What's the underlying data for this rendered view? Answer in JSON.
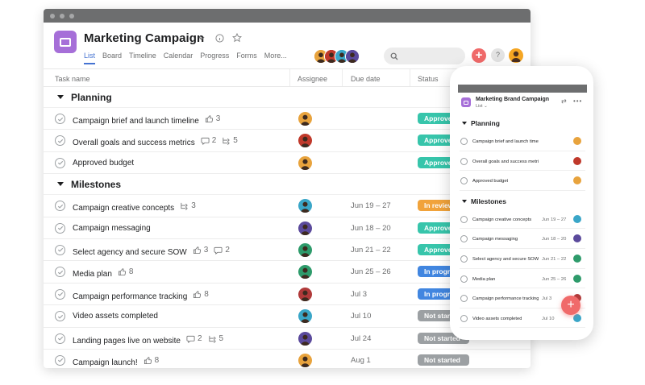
{
  "project": {
    "title": "Marketing Campaign",
    "tabs": [
      "List",
      "Board",
      "Timeline",
      "Calendar",
      "Progress",
      "Forms",
      "More..."
    ],
    "active_tab": "List",
    "icon": "project-list-icon",
    "accent": "#a66fd8"
  },
  "columns": {
    "task": "Task name",
    "assignee": "Assignee",
    "due": "Due date",
    "status": "Status"
  },
  "colors": {
    "approved": "#37c5ab",
    "in_review": "#f1a33b",
    "in_progress": "#4186e0",
    "not_started": "#9ca0a3",
    "add": "#f06a6a"
  },
  "sections": [
    {
      "title": "Planning",
      "tasks": [
        {
          "name": "Campaign brief and launch timeline",
          "likes": "3",
          "comments": "",
          "subtasks": "",
          "due": "",
          "status": "Approved",
          "status_key": "approved",
          "avatar": "#e8a33d"
        },
        {
          "name": "Overall goals and success metrics",
          "likes": "",
          "comments": "2",
          "subtasks": "5",
          "due": "",
          "status": "Approved",
          "status_key": "approved",
          "avatar": "#c0392b"
        },
        {
          "name": "Approved budget",
          "likes": "",
          "comments": "",
          "subtasks": "",
          "due": "",
          "status": "Approved",
          "status_key": "approved",
          "avatar": "#e8a33d"
        }
      ]
    },
    {
      "title": "Milestones",
      "tasks": [
        {
          "name": "Campaign creative concepts",
          "likes": "",
          "comments": "",
          "subtasks": "3",
          "due": "Jun 19 – 27",
          "status": "In review",
          "status_key": "in_review",
          "avatar": "#3aa6c8"
        },
        {
          "name": "Campaign messaging",
          "likes": "",
          "comments": "",
          "subtasks": "",
          "due": "Jun 18 – 20",
          "status": "Approved",
          "status_key": "approved",
          "avatar": "#5b4a9c"
        },
        {
          "name": "Select agency and secure SOW",
          "likes": "3",
          "comments": "2",
          "subtasks": "",
          "due": "Jun 21 – 22",
          "status": "Approved",
          "status_key": "approved",
          "avatar": "#2e9b6b"
        },
        {
          "name": "Media plan",
          "likes": "8",
          "comments": "",
          "subtasks": "",
          "due": "Jun 25 – 26",
          "status": "In progress",
          "status_key": "in_progress",
          "avatar": "#2e9b6b"
        },
        {
          "name": "Campaign performance tracking",
          "likes": "8",
          "comments": "",
          "subtasks": "",
          "due": "Jul 3",
          "status": "In progress",
          "status_key": "in_progress",
          "avatar": "#b03a3a"
        },
        {
          "name": "Video assets completed",
          "likes": "",
          "comments": "",
          "subtasks": "",
          "due": "Jul 10",
          "status": "Not started",
          "status_key": "not_started",
          "avatar": "#3aa6c8"
        },
        {
          "name": "Landing pages live on website",
          "likes": "",
          "comments": "2",
          "subtasks": "5",
          "due": "Jul 24",
          "status": "Not started",
          "status_key": "not_started",
          "avatar": "#5b4a9c"
        },
        {
          "name": "Campaign launch!",
          "likes": "8",
          "comments": "",
          "subtasks": "",
          "due": "Aug 1",
          "status": "Not started",
          "status_key": "not_started",
          "avatar": "#e8a33d"
        }
      ]
    }
  ],
  "header_avatars": [
    "#e8a33d",
    "#c0392b",
    "#3aa6c8",
    "#5b4a9c"
  ],
  "help_label": "?",
  "mobile": {
    "title": "Marketing Brand Campaign",
    "view": "List",
    "sections": [
      {
        "title": "Planning",
        "tasks": [
          {
            "name": "Campaign brief and launch timeline",
            "due": "",
            "avatar": "#e8a33d"
          },
          {
            "name": "Overall goals and success metrics",
            "due": "",
            "avatar": "#c0392b"
          },
          {
            "name": "Approved budget",
            "due": "",
            "avatar": "#e8a33d"
          }
        ]
      },
      {
        "title": "Milestones",
        "tasks": [
          {
            "name": "Campaign creative concepts",
            "due": "Jun 19 – 27",
            "avatar": "#3aa6c8"
          },
          {
            "name": "Campaign messaging",
            "due": "Jun 18 – 20",
            "avatar": "#5b4a9c"
          },
          {
            "name": "Select agency and secure SOW",
            "due": "Jun 21 – 22",
            "avatar": "#2e9b6b"
          },
          {
            "name": "Media plan",
            "due": "Jun 25 – 26",
            "avatar": "#2e9b6b"
          },
          {
            "name": "Campaign performance tracking",
            "due": "Jul 3",
            "avatar": "#b03a3a"
          },
          {
            "name": "Video assets completed",
            "due": "Jul 10",
            "avatar": "#3aa6c8"
          }
        ]
      }
    ]
  }
}
